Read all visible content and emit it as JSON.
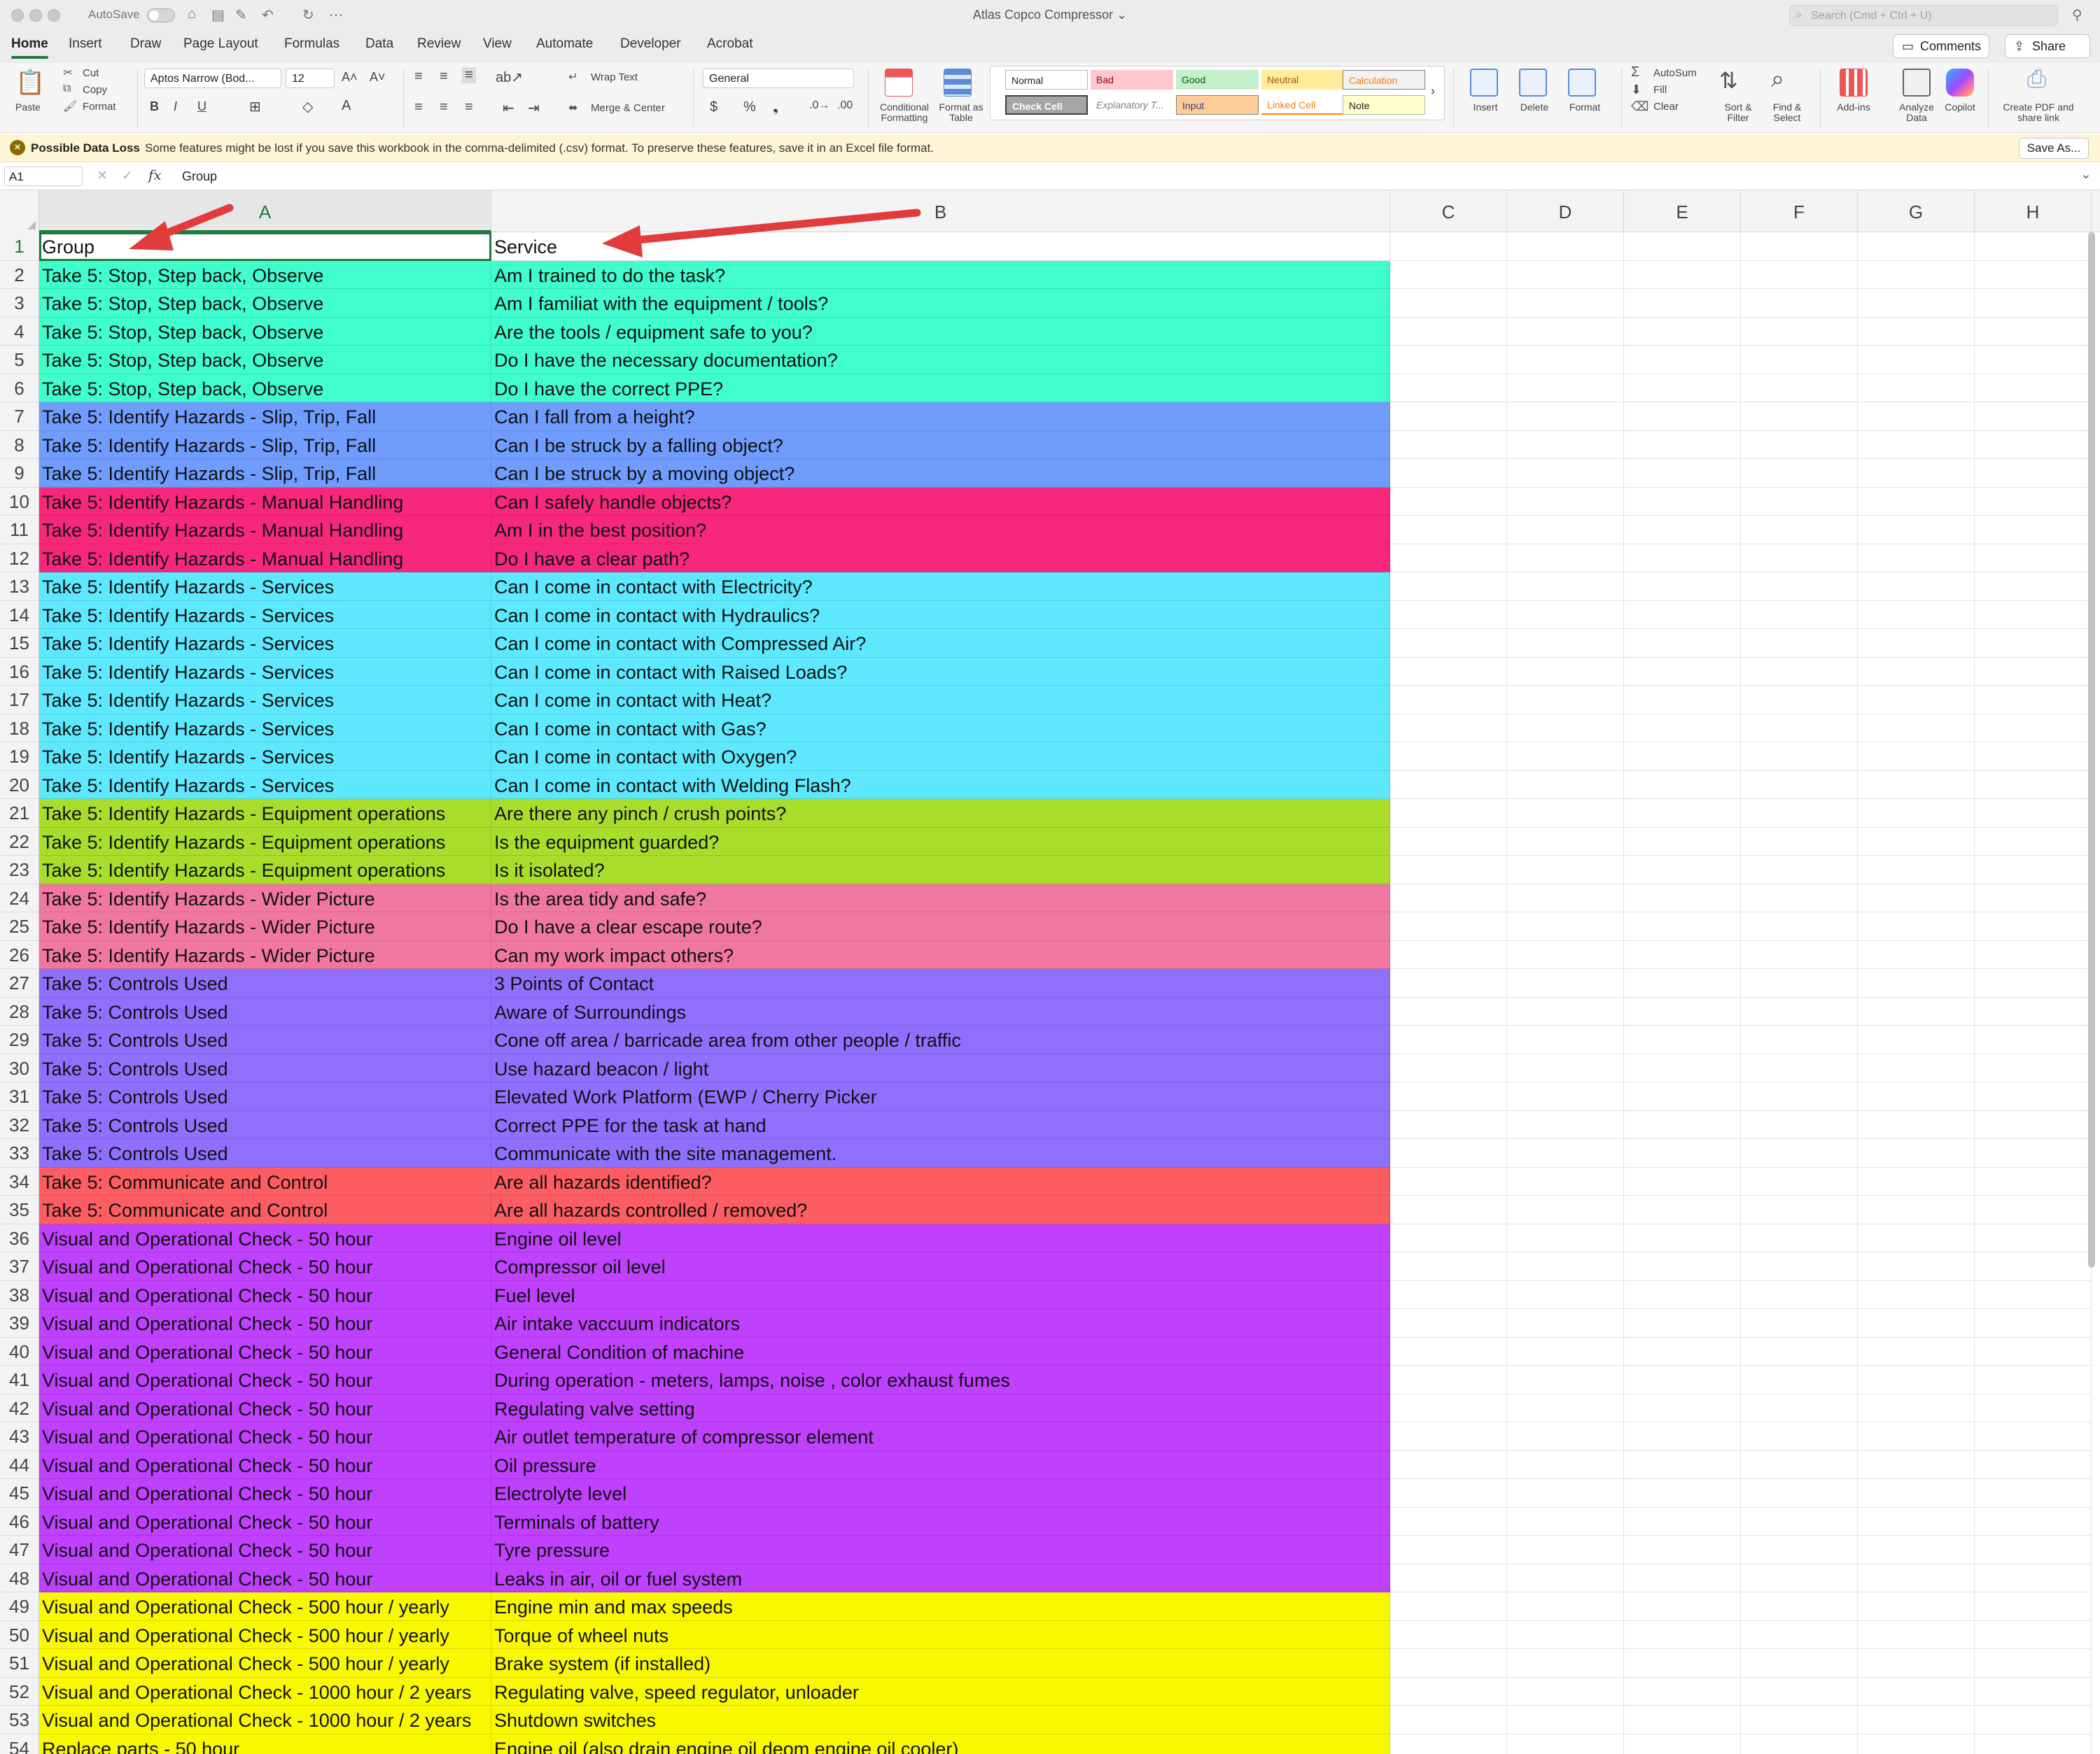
{
  "titlebar": {
    "autosave_label": "AutoSave",
    "doc_title": "Atlas Copco Compressor ⌄",
    "search_placeholder": "Search (Cmd + Ctrl + U)"
  },
  "tabs": [
    "Home",
    "Insert",
    "Draw",
    "Page Layout",
    "Formulas",
    "Data",
    "Review",
    "View",
    "Automate",
    "Developer",
    "Acrobat"
  ],
  "header_buttons": {
    "comments": "Comments",
    "share": "Share"
  },
  "ribbon": {
    "paste": "Paste",
    "cut": "Cut",
    "copy": "Copy",
    "format_painter": "Format",
    "font_name": "Aptos Narrow (Bod...",
    "font_size": "12",
    "wrap_text": "Wrap Text",
    "merge_center": "Merge & Center",
    "number_format": "General",
    "conditional_formatting": "Conditional Formatting",
    "format_as_table": "Format as Table",
    "styles": [
      "Normal",
      "Bad",
      "Good",
      "Neutral",
      "Calculation",
      "Check Cell",
      "Explanatory T...",
      "Input",
      "Linked Cell",
      "Note"
    ],
    "insert": "Insert",
    "delete": "Delete",
    "format": "Format",
    "autosum": "AutoSum",
    "fill": "Fill",
    "clear": "Clear",
    "sort_filter": "Sort & Filter",
    "find_select": "Find & Select",
    "add_ins": "Add-ins",
    "analyze_data": "Analyze Data",
    "copilot": "Copilot",
    "create_pdf": "Create PDF and share link"
  },
  "message_bar": {
    "title": "Possible Data Loss",
    "text": "Some features might be lost if you save this workbook in the comma-delimited (.csv) format. To preserve these features, save it in an Excel file format.",
    "save_as": "Save As..."
  },
  "formula_bar": {
    "name_box": "A1",
    "fx": "fx",
    "value": "Group"
  },
  "columns": [
    "A",
    "B",
    "C",
    "D",
    "E",
    "F",
    "G",
    "H"
  ],
  "colors": {
    "green": "#3ffdcc",
    "blue": "#6f9cfd",
    "red": "#f7287c",
    "cyan": "#5ee8fd",
    "lime": "#a9dd2c",
    "pink": "#f177a3",
    "violet": "#8f70fd",
    "coral": "#fc5d63",
    "purple": "#bf40fd",
    "yellow": "#f8f800",
    "accent": "#1f7a3e",
    "arrow": "#e23b3b"
  },
  "rows": [
    {
      "n": "1",
      "a": "Group",
      "b": "Service",
      "color": ""
    },
    {
      "n": "2",
      "a": "Take 5: Stop, Step back, Observe",
      "b": "Am I trained to do the task?",
      "color": "green"
    },
    {
      "n": "3",
      "a": "Take 5: Stop, Step back, Observe",
      "b": "Am I familiat with the equipment / tools?",
      "color": "green"
    },
    {
      "n": "4",
      "a": "Take 5: Stop, Step back, Observe",
      "b": "Are the tools / equipment safe to you?",
      "color": "green"
    },
    {
      "n": "5",
      "a": "Take 5: Stop, Step back, Observe",
      "b": "Do I have the necessary documentation?",
      "color": "green"
    },
    {
      "n": "6",
      "a": "Take 5: Stop, Step back, Observe",
      "b": "Do I have the correct PPE?",
      "color": "green"
    },
    {
      "n": "7",
      "a": "Take 5: Identify Hazards - Slip, Trip, Fall",
      "b": "Can I fall from a height?",
      "color": "blue"
    },
    {
      "n": "8",
      "a": "Take 5: Identify Hazards - Slip, Trip, Fall",
      "b": "Can I be struck by a falling object?",
      "color": "blue"
    },
    {
      "n": "9",
      "a": "Take 5: Identify Hazards - Slip, Trip, Fall",
      "b": "Can I be struck by a moving object?",
      "color": "blue"
    },
    {
      "n": "10",
      "a": "Take 5: Identify Hazards - Manual Handling",
      "b": "Can I safely handle objects?",
      "color": "red"
    },
    {
      "n": "11",
      "a": "Take 5: Identify Hazards - Manual Handling",
      "b": "Am I in the best position?",
      "color": "red"
    },
    {
      "n": "12",
      "a": "Take 5: Identify Hazards - Manual Handling",
      "b": "Do I have a clear path?",
      "color": "red"
    },
    {
      "n": "13",
      "a": "Take 5: Identify Hazards -  Services",
      "b": "Can I come in contact with Electricity?",
      "color": "cyan"
    },
    {
      "n": "14",
      "a": "Take 5: Identify Hazards -  Services",
      "b": "Can I come in contact with Hydraulics?",
      "color": "cyan"
    },
    {
      "n": "15",
      "a": "Take 5: Identify Hazards -  Services",
      "b": "Can I come in contact with Compressed Air?",
      "color": "cyan"
    },
    {
      "n": "16",
      "a": "Take 5: Identify Hazards -  Services",
      "b": "Can I come in contact with Raised Loads?",
      "color": "cyan"
    },
    {
      "n": "17",
      "a": "Take 5: Identify Hazards -  Services",
      "b": "Can I come in contact with Heat?",
      "color": "cyan"
    },
    {
      "n": "18",
      "a": "Take 5: Identify Hazards -  Services",
      "b": "Can I come in contact with Gas?",
      "color": "cyan"
    },
    {
      "n": "19",
      "a": "Take 5: Identify Hazards -  Services",
      "b": "Can I come in contact with Oxygen?",
      "color": "cyan"
    },
    {
      "n": "20",
      "a": "Take 5: Identify Hazards -  Services",
      "b": "Can I come in contact with Welding Flash?",
      "color": "cyan"
    },
    {
      "n": "21",
      "a": "Take 5: Identify Hazards - Equipment operations",
      "b": "Are there any pinch / crush points?",
      "color": "lime"
    },
    {
      "n": "22",
      "a": "Take 5: Identify Hazards - Equipment operations",
      "b": "Is the equipment guarded?",
      "color": "lime"
    },
    {
      "n": "23",
      "a": "Take 5: Identify Hazards - Equipment operations",
      "b": "Is it isolated?",
      "color": "lime"
    },
    {
      "n": "24",
      "a": "Take 5: Identify Hazards - Wider Picture",
      "b": "Is the area tidy and safe?",
      "color": "pink"
    },
    {
      "n": "25",
      "a": "Take 5: Identify Hazards - Wider Picture",
      "b": "Do I have a clear escape route?",
      "color": "pink"
    },
    {
      "n": "26",
      "a": "Take 5: Identify Hazards - Wider Picture",
      "b": "Can my work impact others?",
      "color": "pink"
    },
    {
      "n": "27",
      "a": "Take 5: Controls Used",
      "b": "3 Points of Contact",
      "color": "violet"
    },
    {
      "n": "28",
      "a": "Take 5: Controls Used",
      "b": "Aware of Surroundings",
      "color": "violet"
    },
    {
      "n": "29",
      "a": "Take 5: Controls Used",
      "b": "Cone off area / barricade area from other people / traffic",
      "color": "violet"
    },
    {
      "n": "30",
      "a": "Take 5: Controls Used",
      "b": "Use hazard beacon / light",
      "color": "violet"
    },
    {
      "n": "31",
      "a": "Take 5: Controls Used",
      "b": "Elevated Work Platform (EWP / Cherry Picker",
      "color": "violet"
    },
    {
      "n": "32",
      "a": "Take 5: Controls Used",
      "b": "Correct PPE for the task at hand",
      "color": "violet"
    },
    {
      "n": "33",
      "a": "Take 5: Controls Used",
      "b": "Communicate with the site management.",
      "color": "violet"
    },
    {
      "n": "34",
      "a": "Take 5: Communicate and Control",
      "b": "Are all hazards identified?",
      "color": "coral"
    },
    {
      "n": "35",
      "a": "Take 5: Communicate and Control",
      "b": "Are all hazards controlled / removed?",
      "color": "coral"
    },
    {
      "n": "36",
      "a": "Visual and Operational Check - 50 hour",
      "b": "Engine oil level",
      "color": "purple"
    },
    {
      "n": "37",
      "a": "Visual and Operational Check - 50 hour",
      "b": "Compressor oil level",
      "color": "purple"
    },
    {
      "n": "38",
      "a": "Visual and Operational Check - 50 hour",
      "b": "Fuel level",
      "color": "purple"
    },
    {
      "n": "39",
      "a": "Visual and Operational Check - 50 hour",
      "b": "Air intake vaccuum indicators",
      "color": "purple"
    },
    {
      "n": "40",
      "a": "Visual and Operational Check - 50 hour",
      "b": "General Condition of machine",
      "color": "purple"
    },
    {
      "n": "41",
      "a": "Visual and Operational Check - 50 hour",
      "b": "During operation - meters, lamps, noise , color exhaust fumes",
      "color": "purple"
    },
    {
      "n": "42",
      "a": "Visual and Operational Check - 50 hour",
      "b": "Regulating valve setting",
      "color": "purple"
    },
    {
      "n": "43",
      "a": "Visual and Operational Check - 50 hour",
      "b": "Air outlet temperature of compressor element",
      "color": "purple"
    },
    {
      "n": "44",
      "a": "Visual and Operational Check - 50 hour",
      "b": "Oil pressure",
      "color": "purple"
    },
    {
      "n": "45",
      "a": "Visual and Operational Check - 50 hour",
      "b": "Electrolyte level",
      "color": "purple"
    },
    {
      "n": "46",
      "a": "Visual and Operational Check - 50 hour",
      "b": "Terminals of battery",
      "color": "purple"
    },
    {
      "n": "47",
      "a": "Visual and Operational Check - 50 hour",
      "b": "Tyre pressure",
      "color": "purple"
    },
    {
      "n": "48",
      "a": "Visual and Operational Check - 50 hour",
      "b": "Leaks in air, oil or fuel system",
      "color": "purple"
    },
    {
      "n": "49",
      "a": "Visual and Operational Check - 500 hour / yearly",
      "b": "Engine min and max speeds",
      "color": "yellow"
    },
    {
      "n": "50",
      "a": "Visual and Operational Check - 500 hour / yearly",
      "b": "Torque of wheel nuts",
      "color": "yellow"
    },
    {
      "n": "51",
      "a": "Visual and Operational Check - 500 hour / yearly",
      "b": "Brake system (if installed)",
      "color": "yellow"
    },
    {
      "n": "52",
      "a": "Visual and Operational Check - 1000 hour / 2 years",
      "b": "Regulating valve, speed regulator, unloader",
      "color": "yellow"
    },
    {
      "n": "53",
      "a": "Visual and Operational Check - 1000 hour / 2 years",
      "b": "Shutdown switches",
      "color": "yellow"
    },
    {
      "n": "54",
      "a": "Replace parts - 50 hour",
      "b": "Engine oil (also drain engine oil deom engine oil cooler)",
      "color": "yellow"
    }
  ]
}
